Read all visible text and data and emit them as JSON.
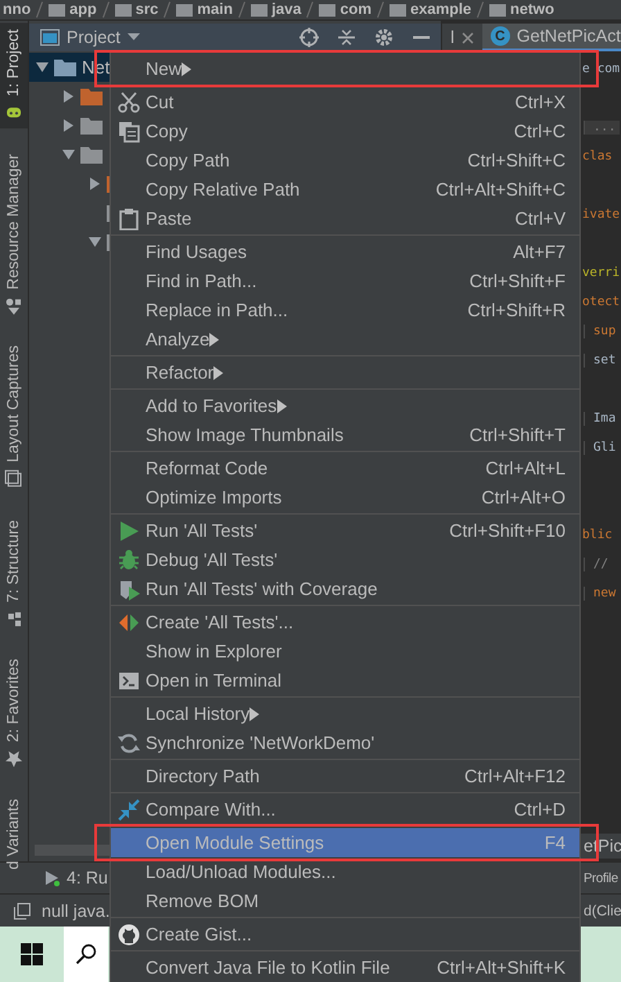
{
  "breadcrumb": [
    {
      "label": "nno"
    },
    {
      "label": "app"
    },
    {
      "label": "src"
    },
    {
      "label": "main"
    },
    {
      "label": "java"
    },
    {
      "label": "com"
    },
    {
      "label": "example"
    },
    {
      "label": "netwo"
    }
  ],
  "tool_strip": [
    {
      "label": "1: Project",
      "selected": true
    },
    {
      "label": "Resource Manager",
      "selected": false
    },
    {
      "label": "Layout Captures",
      "selected": false
    },
    {
      "label": "7: Structure",
      "selected": false
    },
    {
      "label": "2: Favorites",
      "selected": false
    },
    {
      "label": "d Variants",
      "selected": false
    }
  ],
  "project_panel": {
    "title": "Project",
    "tree": [
      {
        "label": "Net",
        "expanded": true,
        "selected": true,
        "color": "#7f9bb3",
        "children": [
          {
            "expanded": false,
            "selected": false,
            "color": "#c0632e"
          },
          {
            "expanded": false,
            "selected": false,
            "color": "#8e9194"
          },
          {
            "expanded": true,
            "selected": false,
            "color": "#8e9194",
            "children": [
              {
                "expanded": false,
                "selected": false,
                "color": "#c0632e"
              },
              {
                "selected": false,
                "color": "#8e9194"
              },
              {
                "expanded": true,
                "selected": false,
                "color": "#8e9194"
              }
            ]
          }
        ]
      }
    ]
  },
  "editor": {
    "tabs": [
      {
        "label": "l",
        "selected": false
      },
      {
        "label": "GetNetPicAct",
        "badge": "C",
        "selected": true
      }
    ],
    "lines": [
      {
        "kind": "plain",
        "text": "e com",
        "indented": false
      },
      {
        "kind": "blank"
      },
      {
        "kind": "fold",
        "text": "...",
        "indented": true
      },
      {
        "kind": "keyword",
        "text": "clas",
        "indented": false
      },
      {
        "kind": "blank"
      },
      {
        "kind": "keyword",
        "text": "ivate",
        "indented": false
      },
      {
        "kind": "blank"
      },
      {
        "kind": "annotation",
        "text": "verri",
        "indented": false
      },
      {
        "kind": "keyword",
        "text": "otect",
        "indented": false
      },
      {
        "kind": "keyword",
        "text": "sup",
        "indented": true
      },
      {
        "kind": "plain",
        "text": "set",
        "indented": true
      },
      {
        "kind": "blank"
      },
      {
        "kind": "plain",
        "text": "Ima",
        "indented": true
      },
      {
        "kind": "plain",
        "text": "Gli",
        "indented": true
      },
      {
        "kind": "blank"
      },
      {
        "kind": "blank"
      },
      {
        "kind": "keyword",
        "text": "blic",
        "indented": false
      },
      {
        "kind": "comment",
        "text": "//",
        "indented": true
      },
      {
        "kind": "keyword",
        "text": "new",
        "indented": true
      }
    ],
    "footer_tab": "etPic"
  },
  "menu": {
    "items": [
      {
        "label": "New",
        "submenu": true,
        "kind": "none",
        "separator_before": false,
        "selected": false,
        "framed": true
      },
      {
        "label": "Cut",
        "shortcut": "Ctrl+X",
        "submenu": false,
        "kind": "cut",
        "separator_before": true,
        "selected": false,
        "framed": false
      },
      {
        "label": "Copy",
        "shortcut": "Ctrl+C",
        "submenu": false,
        "kind": "copy",
        "separator_before": false,
        "selected": false,
        "framed": false
      },
      {
        "label": "Copy Path",
        "shortcut": "Ctrl+Shift+C",
        "submenu": false,
        "kind": "none",
        "separator_before": false,
        "selected": false,
        "framed": false
      },
      {
        "label": "Copy Relative Path",
        "shortcut": "Ctrl+Alt+Shift+C",
        "submenu": false,
        "kind": "none",
        "separator_before": false,
        "selected": false,
        "framed": false
      },
      {
        "label": "Paste",
        "shortcut": "Ctrl+V",
        "submenu": false,
        "kind": "paste",
        "separator_before": false,
        "selected": false,
        "framed": false
      },
      {
        "label": "Find Usages",
        "shortcut": "Alt+F7",
        "submenu": false,
        "kind": "none",
        "separator_before": true,
        "selected": false,
        "framed": false
      },
      {
        "label": "Find in Path...",
        "shortcut": "Ctrl+Shift+F",
        "submenu": false,
        "kind": "none",
        "separator_before": false,
        "selected": false,
        "framed": false
      },
      {
        "label": "Replace in Path...",
        "shortcut": "Ctrl+Shift+R",
        "submenu": false,
        "kind": "none",
        "separator_before": false,
        "selected": false,
        "framed": false
      },
      {
        "label": "Analyze",
        "submenu": true,
        "kind": "none",
        "separator_before": false,
        "selected": false,
        "framed": false
      },
      {
        "label": "Refactor",
        "submenu": true,
        "kind": "none",
        "separator_before": true,
        "selected": false,
        "framed": false
      },
      {
        "label": "Add to Favorites",
        "submenu": true,
        "kind": "none",
        "separator_before": true,
        "selected": false,
        "framed": false
      },
      {
        "label": "Show Image Thumbnails",
        "shortcut": "Ctrl+Shift+T",
        "submenu": false,
        "kind": "none",
        "separator_before": false,
        "selected": false,
        "framed": false
      },
      {
        "label": "Reformat Code",
        "shortcut": "Ctrl+Alt+L",
        "submenu": false,
        "kind": "none",
        "separator_before": true,
        "selected": false,
        "framed": false
      },
      {
        "label": "Optimize Imports",
        "shortcut": "Ctrl+Alt+O",
        "submenu": false,
        "kind": "none",
        "separator_before": false,
        "selected": false,
        "framed": false
      },
      {
        "label": "Run 'All Tests'",
        "shortcut": "Ctrl+Shift+F10",
        "submenu": false,
        "kind": "run",
        "separator_before": true,
        "selected": false,
        "framed": false
      },
      {
        "label": "Debug 'All Tests'",
        "submenu": false,
        "kind": "debug",
        "separator_before": false,
        "selected": false,
        "framed": false
      },
      {
        "label": "Run 'All Tests' with Coverage",
        "submenu": false,
        "kind": "coverage",
        "separator_before": false,
        "selected": false,
        "framed": false
      },
      {
        "label": "Create 'All Tests'...",
        "submenu": false,
        "kind": "create",
        "separator_before": true,
        "selected": false,
        "framed": false
      },
      {
        "label": "Show in Explorer",
        "submenu": false,
        "kind": "none",
        "separator_before": false,
        "selected": false,
        "framed": false
      },
      {
        "label": "Open in Terminal",
        "submenu": false,
        "kind": "terminal",
        "separator_before": false,
        "selected": false,
        "framed": false
      },
      {
        "label": "Local History",
        "submenu": true,
        "kind": "none",
        "separator_before": true,
        "selected": false,
        "framed": false
      },
      {
        "label": "Synchronize 'NetWorkDemo'",
        "submenu": false,
        "kind": "sync",
        "separator_before": false,
        "selected": false,
        "framed": false
      },
      {
        "label": "Directory Path",
        "shortcut": "Ctrl+Alt+F12",
        "submenu": false,
        "kind": "none",
        "separator_before": true,
        "selected": false,
        "framed": false
      },
      {
        "label": "Compare With...",
        "shortcut": "Ctrl+D",
        "submenu": false,
        "kind": "compare",
        "separator_before": true,
        "selected": false,
        "framed": false
      },
      {
        "label": "Open Module Settings",
        "shortcut": "F4",
        "submenu": false,
        "kind": "none",
        "separator_before": true,
        "selected": true,
        "framed": true
      },
      {
        "label": "Load/Unload Modules...",
        "submenu": false,
        "kind": "none",
        "separator_before": false,
        "selected": false,
        "framed": false
      },
      {
        "label": "Remove BOM",
        "submenu": false,
        "kind": "none",
        "separator_before": false,
        "selected": false,
        "framed": false
      },
      {
        "label": "Create Gist...",
        "submenu": false,
        "kind": "gist",
        "separator_before": true,
        "selected": false,
        "framed": false
      },
      {
        "label": "Convert Java File to Kotlin File",
        "shortcut": "Ctrl+Alt+Shift+K",
        "submenu": false,
        "kind": "none",
        "separator_before": true,
        "selected": false,
        "framed": false
      }
    ]
  },
  "run_bar": {
    "tab": "4: Ru",
    "right_text": "Profile"
  },
  "status_bar": {
    "text": "null java.",
    "right_text": "d(Clie"
  }
}
